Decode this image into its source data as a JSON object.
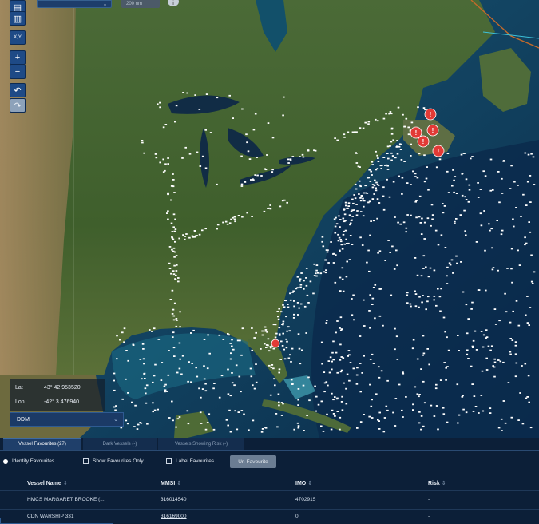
{
  "toolbar": {
    "layers_icon": "layers-icon",
    "book_icon": "book-icon",
    "xy_label": "X,Y",
    "zoom_in": "+",
    "zoom_out": "−",
    "undo": "↶",
    "redo": "↷"
  },
  "top_controls": {
    "select_value": "",
    "distance_value": "200 nm",
    "info_icon": "info-icon"
  },
  "coordinates": {
    "lat_label": "Lat",
    "lat_value": "43° 42.953520",
    "lon_label": "Lon",
    "lon_value": "-42° 3.476940",
    "format": "DDM"
  },
  "tabs": [
    {
      "label": "Vessel Favourites (27)",
      "active": true
    },
    {
      "label": "Dark Vessels (-)",
      "active": false
    },
    {
      "label": "Vessels Showing Risk (-)",
      "active": false
    }
  ],
  "options": {
    "identify_favourites": "Identify Favourites",
    "show_favourites_only": "Show Favourites Only",
    "label_favourites": "Label Favourites",
    "unfavourite_button": "Un-Favourite"
  },
  "table": {
    "columns": [
      "Vessel Name",
      "MMSI",
      "IMO",
      "Risk"
    ],
    "sort_glyph": "⇕",
    "rows": [
      [
        "HMCS MARGARET BROOKE (...",
        "316014540",
        "4702915",
        "-"
      ],
      [
        "CDN WARSHIP 331",
        "316169000",
        "0",
        "-"
      ]
    ]
  },
  "map": {
    "ocean_color": "#0f3a57",
    "land_color": "#4a6633",
    "vessel_color": "#ffffff",
    "alert_color": "#e23a36",
    "alert_markers": 6
  }
}
